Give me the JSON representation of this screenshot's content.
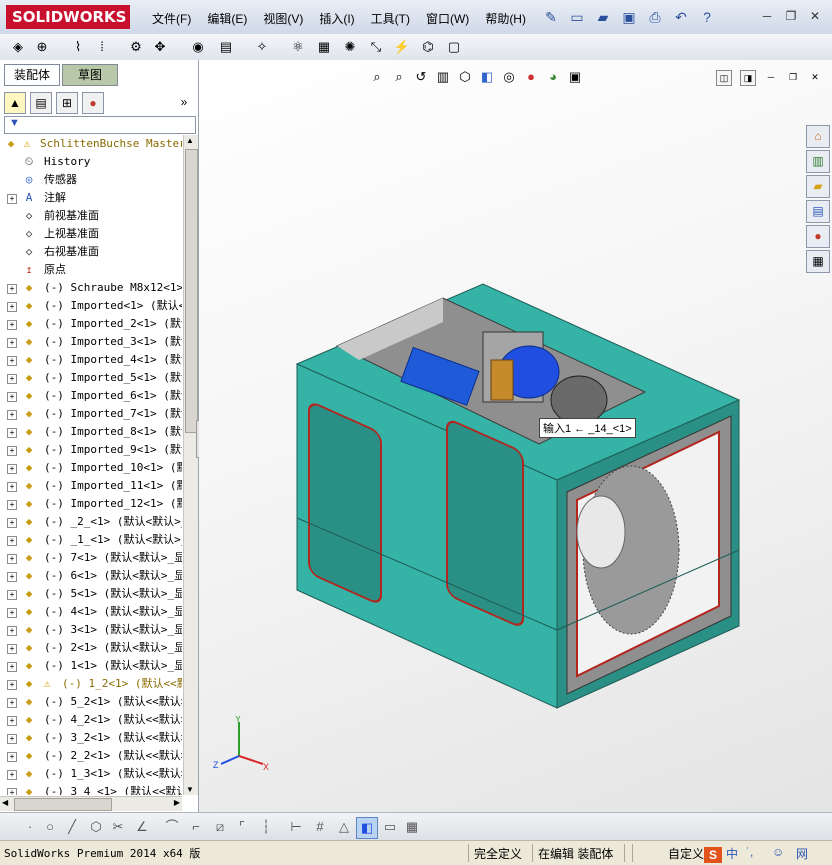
{
  "app": {
    "logo": "SOLIDWORKS",
    "menu": [
      "文件(F)",
      "编辑(E)",
      "视图(V)",
      "插入(I)",
      "工具(T)",
      "窗口(W)",
      "帮助(H)"
    ],
    "help_symbol": "?"
  },
  "panel": {
    "tabs": [
      "装配体",
      "草图"
    ],
    "root": "SchlittenBuchse Master",
    "items": [
      {
        "label": "History",
        "icon": "history-icon",
        "expand": false
      },
      {
        "label": "传感器",
        "icon": "sensor-icon",
        "expand": false
      },
      {
        "label": "注解",
        "icon": "annotation-icon",
        "expand": true
      },
      {
        "label": "前视基准面",
        "icon": "plane-icon",
        "expand": false
      },
      {
        "label": "上视基准面",
        "icon": "plane-icon",
        "expand": false
      },
      {
        "label": "右视基准面",
        "icon": "plane-icon",
        "expand": false
      },
      {
        "label": "原点",
        "icon": "origin-icon",
        "expand": false
      },
      {
        "label": "(-) Schraube M8x12<1> (",
        "icon": "part-icon",
        "expand": true
      },
      {
        "label": "(-) Imported<1> (默认<<",
        "icon": "part-icon",
        "expand": true
      },
      {
        "label": "(-) Imported_2<1> (默认",
        "icon": "part-icon",
        "expand": true
      },
      {
        "label": "(-) Imported_3<1> (默认",
        "icon": "part-icon",
        "expand": true
      },
      {
        "label": "(-) Imported_4<1> (默认",
        "icon": "part-icon",
        "expand": true
      },
      {
        "label": "(-) Imported_5<1> (默认",
        "icon": "part-icon",
        "expand": true
      },
      {
        "label": "(-) Imported_6<1> (默认",
        "icon": "part-icon",
        "expand": true
      },
      {
        "label": "(-) Imported_7<1> (默认",
        "icon": "part-icon",
        "expand": true
      },
      {
        "label": "(-) Imported_8<1> (默认",
        "icon": "part-icon",
        "expand": true
      },
      {
        "label": "(-) Imported_9<1> (默认",
        "icon": "part-icon",
        "expand": true
      },
      {
        "label": "(-) Imported_10<1> (默认",
        "icon": "part-icon",
        "expand": true
      },
      {
        "label": "(-) Imported_11<1> (默认",
        "icon": "part-icon",
        "expand": true
      },
      {
        "label": "(-) Imported_12<1> (默认",
        "icon": "part-icon",
        "expand": true
      },
      {
        "label": "(-) _2_<1> (默认<默认>_",
        "icon": "part-icon",
        "expand": true
      },
      {
        "label": "(-) _1_<1> (默认<默认>_",
        "icon": "part-icon",
        "expand": true
      },
      {
        "label": "(-) 7<1> (默认<默认>_显",
        "icon": "part-icon",
        "expand": true
      },
      {
        "label": "(-) 6<1> (默认<默认>_显",
        "icon": "part-icon",
        "expand": true
      },
      {
        "label": "(-) 5<1> (默认<默认>_显",
        "icon": "part-icon",
        "expand": true
      },
      {
        "label": "(-) 4<1> (默认<默认>_显",
        "icon": "part-icon",
        "expand": true
      },
      {
        "label": "(-) 3<1> (默认<默认>_显",
        "icon": "part-icon",
        "expand": true
      },
      {
        "label": "(-) 2<1> (默认<默认>_显",
        "icon": "part-icon",
        "expand": true
      },
      {
        "label": "(-) 1<1> (默认<默认>_显",
        "icon": "part-icon",
        "expand": true
      },
      {
        "label": "(-) 1_2<1> (默认<<默",
        "icon": "warning-part-icon",
        "expand": true,
        "warning": true
      },
      {
        "label": "(-) 5_2<1> (默认<<默认>",
        "icon": "part-icon",
        "expand": true
      },
      {
        "label": "(-) 4_2<1> (默认<<默认>",
        "icon": "part-icon",
        "expand": true
      },
      {
        "label": "(-) 3_2<1> (默认<<默认>",
        "icon": "part-icon",
        "expand": true
      },
      {
        "label": "(-) 2_2<1> (默认<<默认>",
        "icon": "part-icon",
        "expand": true
      },
      {
        "label": "(-) 1_3<1> (默认<<默认>",
        "icon": "part-icon",
        "expand": true
      },
      {
        "label": "(-) 3_4_<1> (默认<<默认",
        "icon": "part-icon",
        "expand": true
      }
    ]
  },
  "viewport": {
    "callout": "输入1 ← _14_<1>",
    "triad": {
      "x": "X",
      "y": "Y",
      "z": "Z"
    }
  },
  "status": {
    "product": "SolidWorks Premium 2014 x64 版",
    "defined": "完全定义",
    "editing": "在编辑 装配体",
    "custom": "自定义"
  },
  "colors": {
    "brand": "#c8102e",
    "housing": "#35b3a6",
    "housing_dark": "#2a8f84",
    "frame": "#8f8f8f",
    "motor": "#1f4ee0",
    "accent_red": "#b3261e"
  }
}
